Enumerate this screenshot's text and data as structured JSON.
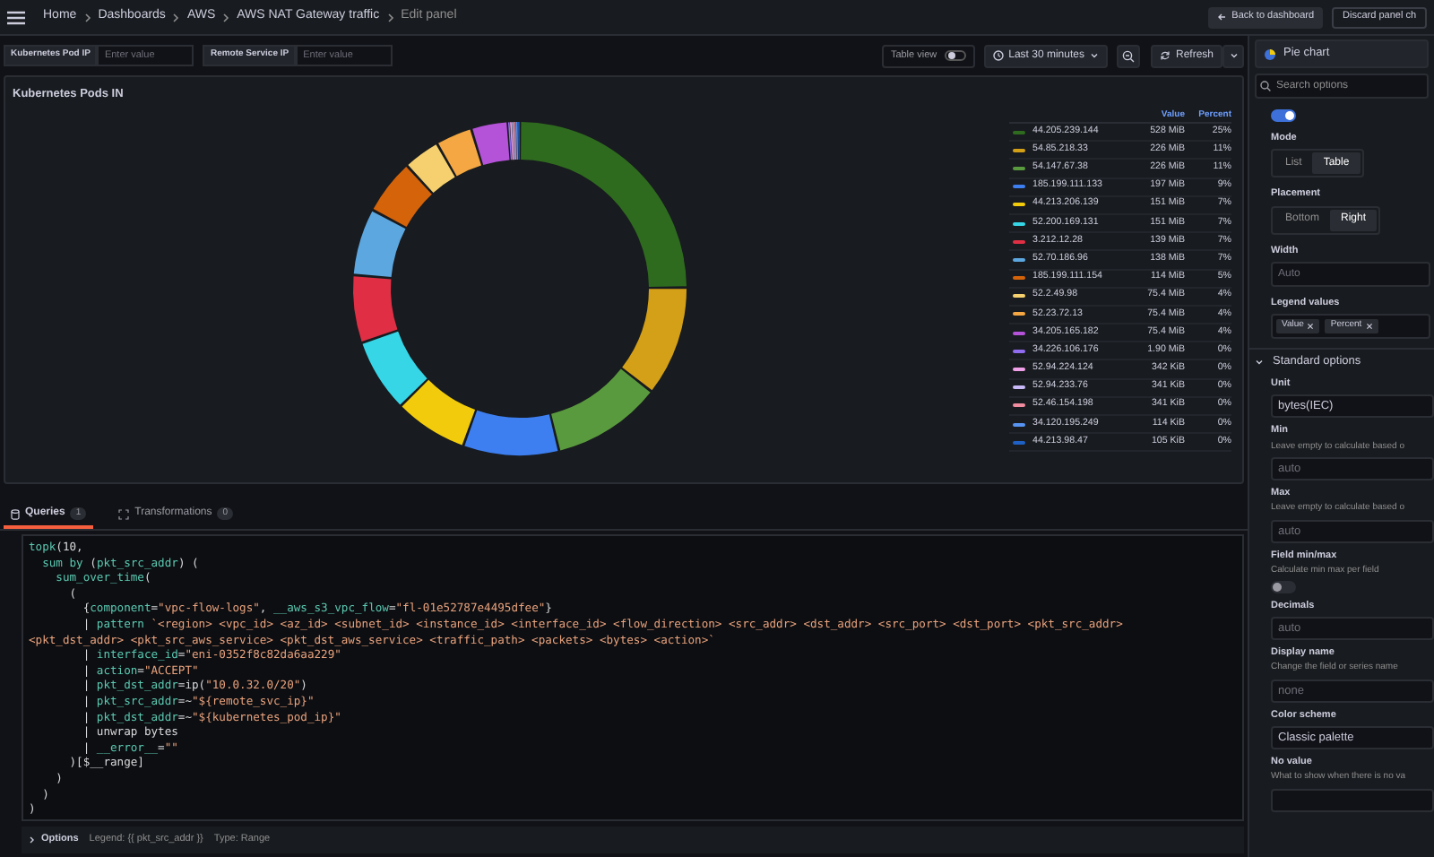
{
  "header": {
    "breadcrumbs": [
      {
        "label": "Home",
        "current": false
      },
      {
        "label": "Dashboards",
        "current": false
      },
      {
        "label": "AWS",
        "current": false
      },
      {
        "label": "AWS NAT Gateway traffic",
        "current": false
      },
      {
        "label": "Edit panel",
        "current": true
      }
    ],
    "back_button": "Back to dashboard",
    "discard_button": "Discard panel ch"
  },
  "variables": [
    {
      "label": "Kubernetes Pod IP",
      "placeholder": "Enter value"
    },
    {
      "label": "Remote Service IP",
      "placeholder": "Enter value"
    }
  ],
  "toolbar": {
    "table_view": {
      "label": "Table view",
      "on": false
    },
    "time_range": "Last 30 minutes",
    "refresh": "Refresh"
  },
  "panel": {
    "title": "Kubernetes Pods IN",
    "legend": {
      "columns": [
        "Value",
        "Percent"
      ],
      "items": [
        {
          "value": "528 MiB",
          "percent": "25%",
          "color": "#2f6b1f"
        },
        {
          "value": "226 MiB",
          "percent": "11%",
          "color": "#d4a017"
        },
        {
          "value": "226 MiB",
          "percent": "11%",
          "color": "#5a9a3e"
        },
        {
          "value": "197 MiB",
          "percent": "9%",
          "color": "#3d7ff0"
        },
        {
          "value": "151 MiB",
          "percent": "7%",
          "color": "#f2cc0c"
        },
        {
          "value": "151 MiB",
          "percent": "7%",
          "color": "#36d6e7"
        },
        {
          "value": "139 MiB",
          "percent": "7%",
          "color": "#e02f44"
        },
        {
          "value": "138 MiB",
          "percent": "7%",
          "color": "#5ca7e0"
        },
        {
          "value": "114 MiB",
          "percent": "5%",
          "color": "#d4630a"
        },
        {
          "value": "75.4 MiB",
          "percent": "4%",
          "color": "#f6d06e"
        },
        {
          "value": "75.4 MiB",
          "percent": "4%",
          "color": "#f4a742"
        },
        {
          "value": "75.4 MiB",
          "percent": "4%",
          "color": "#b452d8"
        },
        {
          "value": "1.90 MiB",
          "percent": "0%",
          "color": "#8f6cf0"
        },
        {
          "value": "342 KiB",
          "percent": "0%",
          "color": "#f0a0e8"
        },
        {
          "value": "341 KiB",
          "percent": "0%",
          "color": "#c8b8f8"
        },
        {
          "value": "341 KiB",
          "percent": "0%",
          "color": "#f08ca0"
        },
        {
          "value": "114 KiB",
          "percent": "0%",
          "color": "#5794f2"
        },
        {
          "value": "105 KiB",
          "percent": "0%",
          "color": "#1f60c4"
        }
      ]
    },
    "chart_data": {
      "type": "donut",
      "categories": [
        "44.205.239.144",
        "54.85.218.33",
        "54.147.67.38",
        "185.199.111.133",
        "44.213.206.139",
        "52.200.169.131",
        "3.212.12.28",
        "52.70.186.96",
        "185.199.111.154",
        "52.2.49.98",
        "52.23.72.13",
        "34.205.165.182",
        "34.226.106.176",
        "52.94.224.124",
        "52.94.233.76",
        "52.46.154.198",
        "34.120.195.249",
        "44.213.98.47"
      ],
      "series": [
        {
          "values": [
            25.15,
            10.765,
            10.765,
            9.384,
            7.193,
            7.193,
            6.621,
            6.574,
            5.43,
            3.592,
            3.592,
            3.592,
            0.091,
            0.016,
            0.016,
            0.016,
            0.005,
            0.005
          ]
        }
      ]
    }
  },
  "query_tabs": [
    {
      "label": "Queries",
      "count": "1",
      "selected": true
    },
    {
      "label": "Transformations",
      "count": "0",
      "selected": false
    }
  ],
  "query": {
    "lines": [
      {
        "tokens": [
          {
            "text": "topk",
            "kind": "fn"
          },
          {
            "text": "(10,",
            "kind": "plain"
          }
        ]
      },
      {
        "tokens": [
          {
            "text": "  sum by",
            "kind": "fn"
          },
          {
            "text": " (",
            "kind": "plain"
          },
          {
            "text": "pkt_src_addr",
            "kind": "fn"
          },
          {
            "text": ") (",
            "kind": "plain"
          }
        ]
      },
      {
        "tokens": [
          {
            "text": "    sum_over_time",
            "kind": "fn"
          },
          {
            "text": "(",
            "kind": "plain"
          }
        ]
      },
      {
        "tokens": [
          {
            "text": "      (",
            "kind": "plain"
          }
        ]
      },
      {
        "tokens": [
          {
            "text": "        {",
            "kind": "plain"
          },
          {
            "text": "component",
            "kind": "fn"
          },
          {
            "text": "=",
            "kind": "plain"
          },
          {
            "text": "\"vpc-flow-logs\"",
            "kind": "str"
          },
          {
            "text": ", ",
            "kind": "plain"
          },
          {
            "text": "__aws_s3_vpc_flow",
            "kind": "fn"
          },
          {
            "text": "=",
            "kind": "plain"
          },
          {
            "text": "\"fl-01e52787e4495dfee\"",
            "kind": "str"
          },
          {
            "text": "}",
            "kind": "plain"
          }
        ]
      },
      {
        "tokens": [
          {
            "text": "        | ",
            "kind": "plain"
          },
          {
            "text": "pattern",
            "kind": "fn"
          },
          {
            "text": " `<region> <vpc_id> <az_id> <subnet_id> <instance_id> <interface_id> <flow_direction> <src_addr> <dst_addr> <src_port> <dst_port> <pkt_src_addr>",
            "kind": "str"
          }
        ]
      },
      {
        "tokens": [
          {
            "text": "<pkt_dst_addr> <pkt_src_aws_service> <pkt_dst_aws_service> <traffic_path> <packets> <bytes> <action>`",
            "kind": "str"
          }
        ]
      },
      {
        "tokens": [
          {
            "text": "        | ",
            "kind": "plain"
          },
          {
            "text": "interface_id",
            "kind": "fn"
          },
          {
            "text": "=",
            "kind": "plain"
          },
          {
            "text": "\"eni-0352f8c82da6aa229\"",
            "kind": "str"
          }
        ]
      },
      {
        "tokens": [
          {
            "text": "        | ",
            "kind": "plain"
          },
          {
            "text": "action",
            "kind": "fn"
          },
          {
            "text": "=",
            "kind": "plain"
          },
          {
            "text": "\"ACCEPT\"",
            "kind": "str"
          }
        ]
      },
      {
        "tokens": [
          {
            "text": "        | ",
            "kind": "plain"
          },
          {
            "text": "pkt_dst_addr",
            "kind": "fn"
          },
          {
            "text": "=ip(",
            "kind": "plain"
          },
          {
            "text": "\"10.0.32.0/20\"",
            "kind": "str"
          },
          {
            "text": ")",
            "kind": "plain"
          }
        ]
      },
      {
        "tokens": [
          {
            "text": "        | ",
            "kind": "plain"
          },
          {
            "text": "pkt_src_addr",
            "kind": "fn"
          },
          {
            "text": "=~",
            "kind": "plain"
          },
          {
            "text": "\"${remote_svc_ip}\"",
            "kind": "str"
          }
        ]
      },
      {
        "tokens": [
          {
            "text": "        | ",
            "kind": "plain"
          },
          {
            "text": "pkt_dst_addr",
            "kind": "fn"
          },
          {
            "text": "=~",
            "kind": "plain"
          },
          {
            "text": "\"${kubernetes_pod_ip}\"",
            "kind": "str"
          }
        ]
      },
      {
        "tokens": [
          {
            "text": "        | unwrap bytes",
            "kind": "plain"
          }
        ]
      },
      {
        "tokens": [
          {
            "text": "        | ",
            "kind": "plain"
          },
          {
            "text": "__error__",
            "kind": "fn"
          },
          {
            "text": "=",
            "kind": "plain"
          },
          {
            "text": "\"\"",
            "kind": "str"
          }
        ]
      },
      {
        "tokens": [
          {
            "text": "      )[$__range]",
            "kind": "plain"
          }
        ]
      },
      {
        "tokens": [
          {
            "text": "    )",
            "kind": "plain"
          }
        ]
      },
      {
        "tokens": [
          {
            "text": "  )",
            "kind": "plain"
          }
        ]
      },
      {
        "tokens": [
          {
            "text": ")",
            "kind": "plain"
          }
        ]
      }
    ],
    "options": {
      "label": "Options",
      "legend": "Legend: {{ pkt_src_addr }}",
      "type": "Type: Range"
    }
  },
  "options_pane": {
    "visualization": "Pie chart",
    "search_placeholder": "Search options",
    "legend_visible": {
      "on": true
    },
    "groups": [
      {
        "kind": "radio",
        "label": "Mode",
        "choices": [
          {
            "label": "List",
            "selected": false
          },
          {
            "label": "Table",
            "selected": true
          }
        ]
      },
      {
        "kind": "radio",
        "label": "Placement",
        "choices": [
          {
            "label": "Bottom",
            "selected": false
          },
          {
            "label": "Right",
            "selected": true
          }
        ]
      },
      {
        "kind": "input",
        "label": "Width",
        "placeholder": "Auto"
      },
      {
        "kind": "chips",
        "label": "Legend values",
        "chips": [
          "Value",
          "Percent"
        ]
      }
    ],
    "section": {
      "title": "Standard options",
      "expanded": true
    },
    "fields": [
      {
        "kind": "input",
        "label": "Unit",
        "value": "bytes(IEC)"
      },
      {
        "kind": "input",
        "label": "Min",
        "description": "Leave empty to calculate based o",
        "placeholder": "auto"
      },
      {
        "kind": "input",
        "label": "Max",
        "description": "Leave empty to calculate based o",
        "placeholder": "auto"
      },
      {
        "kind": "toggle",
        "label": "Field min/max",
        "description": "Calculate min max per field",
        "on": false
      },
      {
        "kind": "input",
        "label": "Decimals",
        "placeholder": "auto"
      },
      {
        "kind": "input",
        "label": "Display name",
        "description": "Change the field or series name",
        "placeholder": "none"
      },
      {
        "kind": "input",
        "label": "Color scheme",
        "value": "Classic palette"
      },
      {
        "kind": "input",
        "label": "No value",
        "description": "What to show when there is no va"
      }
    ]
  }
}
